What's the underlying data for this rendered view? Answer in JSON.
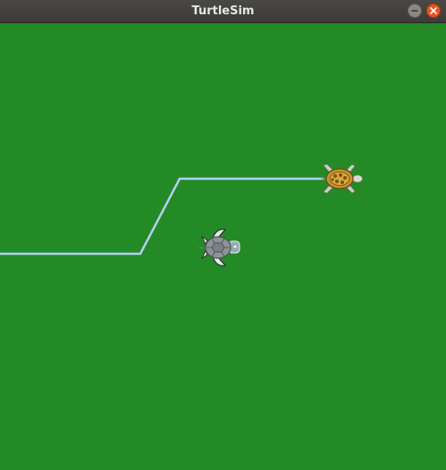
{
  "window": {
    "title": "TurtleSim"
  },
  "titlebar_buttons": {
    "minimize": "minimize-icon",
    "close": "close-icon"
  },
  "colors": {
    "background": "#238a26",
    "pen": "#b3cff5",
    "titlebar": "#3f3e3b",
    "close_button": "#e95420"
  },
  "turtles": [
    {
      "name": "turtle-gray",
      "heading": "east"
    },
    {
      "name": "turtle-orange",
      "heading": "east"
    }
  ]
}
